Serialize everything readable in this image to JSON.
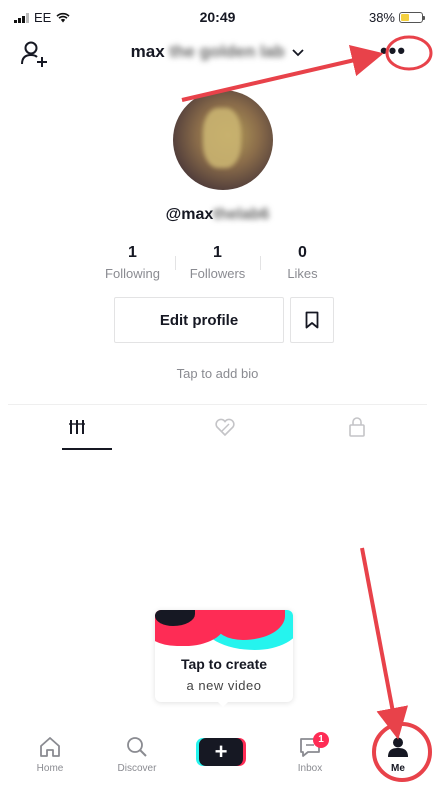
{
  "status_bar": {
    "carrier": "EE",
    "time": "20:49",
    "battery_percent": "38%",
    "battery_level": 0.38
  },
  "header": {
    "title_visible": "max",
    "title_blurred": "the golden lab"
  },
  "profile": {
    "username_visible": "@max",
    "username_blurred": "thelab6",
    "stats": [
      {
        "value": "1",
        "label": "Following"
      },
      {
        "value": "1",
        "label": "Followers"
      },
      {
        "value": "0",
        "label": "Likes"
      }
    ],
    "edit_button": "Edit profile",
    "bio_placeholder": "Tap to add bio"
  },
  "tabs": [
    "videos-grid-icon",
    "liked-videos-icon",
    "private-lock-icon"
  ],
  "create_prompt": {
    "title": "Tap to create",
    "subtitle": "a new video"
  },
  "bottom_nav": {
    "home": "Home",
    "discover": "Discover",
    "inbox": "Inbox",
    "inbox_badge": "1",
    "me": "Me"
  },
  "colors": {
    "accent_red": "#fe2c55",
    "accent_cyan": "#25f4ee",
    "annotation_red": "#e8424a"
  }
}
